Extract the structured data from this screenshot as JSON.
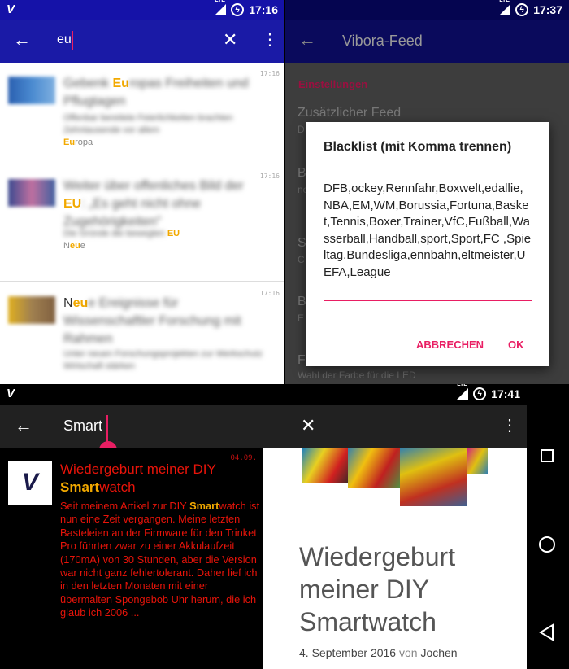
{
  "q1": {
    "time": "17:16",
    "query": "eu",
    "items": [
      {
        "date": "17:16",
        "title_pre": "Gebenk ",
        "title_hl": "Eu",
        "title_post": "ropas Freiheiten und Pflugtagen",
        "desc": "Offenbar bereitete Feierlichkeiten brachten Zehntausende vor allem",
        "desc_hl": "Eu",
        "desc_tail": "ropa"
      },
      {
        "date": "17:16",
        "title_pre": "Weiter über offenliches Bild der ",
        "title_hl": "EU",
        "title_post": ":  „Es geht nicht ohne Zugehörigkeiten\"",
        "desc": "Die Gründe die bewegten",
        "desc_hl": "EU",
        "desc_tail": "",
        "neue_pre": "N",
        "neue_hl": "eu",
        "neue_post": "e"
      },
      {
        "date": "17:16",
        "title_pre": "N",
        "title_hl": "eu",
        "title_post": "e Ereignisse für Wissenschaftler Forschung mit Rahmen",
        "desc": "Unter neuen Forschungsprojekten zur Werkschutz Wirtschaft stärken"
      }
    ]
  },
  "q2": {
    "time": "17:37",
    "title": "Vibora-Feed",
    "section": "Einstellungen",
    "settings": [
      {
        "label": "Zusätzlicher Feed",
        "sub": "D"
      },
      {
        "label": "B",
        "sub": "ne"
      },
      {
        "label": "S",
        "sub": "C"
      },
      {
        "label": "B",
        "sub": "E"
      },
      {
        "label": "F",
        "sub": "Wahl der Farbe für die LED"
      }
    ],
    "dialog": {
      "title": "Blacklist (mit Komma trennen)",
      "value": "DFB,ockey,Rennfahr,Boxwelt,edallie,NBA,EM,WM,Borussia,Fortuna,Basket,Tennis,Boxer,Trainer,VfC,Fußball,Wasserball,Handball,sport,Sport,FC ,Spieltag,Bundesliga,ennbahn,eltmeister,UEFA,League",
      "cancel": "ABBRECHEN",
      "ok": "OK"
    }
  },
  "q3": {
    "time": "17:41",
    "query": "Smart",
    "result": {
      "date": "04.09.",
      "title_pre": "Wiedergeburt meiner DIY ",
      "title_hl": "Smart",
      "title_post": "watch",
      "desc_pre": "Seit meinem Artikel zur DIY ",
      "desc_hl": "Smart",
      "desc_post": "watch ist nun eine Zeit vergangen. Meine letzten Basteleien an der Firmware für den Trinket Pro führten zwar zu einer Akkulaufzeit (170mA) von 30 Stunden, aber die Version war nicht ganz fehlertolerant. Daher lief ich in den letzten Monaten mit einer übermalten Spongebob Uhr herum, die ich glaub ich 2006 ..."
    },
    "article": {
      "title": "Wiedergeburt meiner DIY Smartwatch",
      "date": "4. September 2016",
      "by": "von",
      "author": "Jochen"
    }
  },
  "colors": {
    "primary": "#1a1aa6",
    "accent": "#e91e63",
    "highlight": "#f2a900",
    "darkred": "#e8140a"
  }
}
